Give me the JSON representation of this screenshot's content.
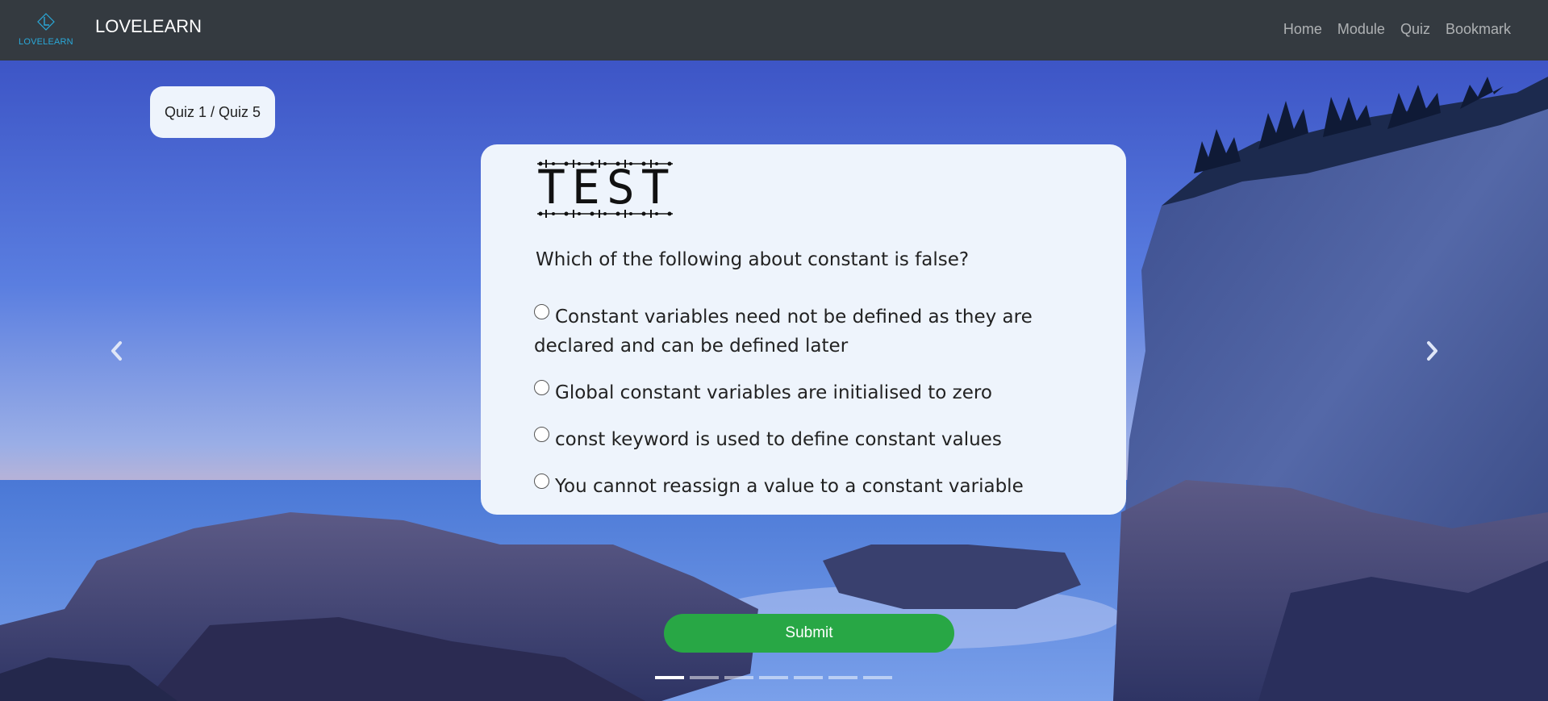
{
  "header": {
    "logo_text": "LOVELEARN",
    "brand": "LOVELEARN",
    "nav": [
      "Home",
      "Module",
      "Quiz",
      "Bookmark"
    ]
  },
  "quiz": {
    "counter": "Quiz 1 / Quiz 5",
    "title": "TEST",
    "question": "Which of the following about constant is false?",
    "options": [
      {
        "label": "Constant variables need not be defined as they are declared and can be defined later",
        "selected": false
      },
      {
        "label": "Global constant variables are initialised to zero",
        "selected": false
      },
      {
        "label": "const keyword is used to define constant values",
        "selected": false
      },
      {
        "label": "You cannot reassign a value to a constant variable",
        "selected": false
      }
    ],
    "submit_label": "Submit"
  },
  "carousel": {
    "slide_count": 7,
    "active_index": 0
  },
  "colors": {
    "navbar": "#343a40",
    "card": "#eef4fc",
    "submit": "#28a745",
    "logo_accent": "#2aa8d8"
  },
  "icons": {
    "prev": "chevron-left-icon",
    "next": "chevron-right-icon"
  }
}
